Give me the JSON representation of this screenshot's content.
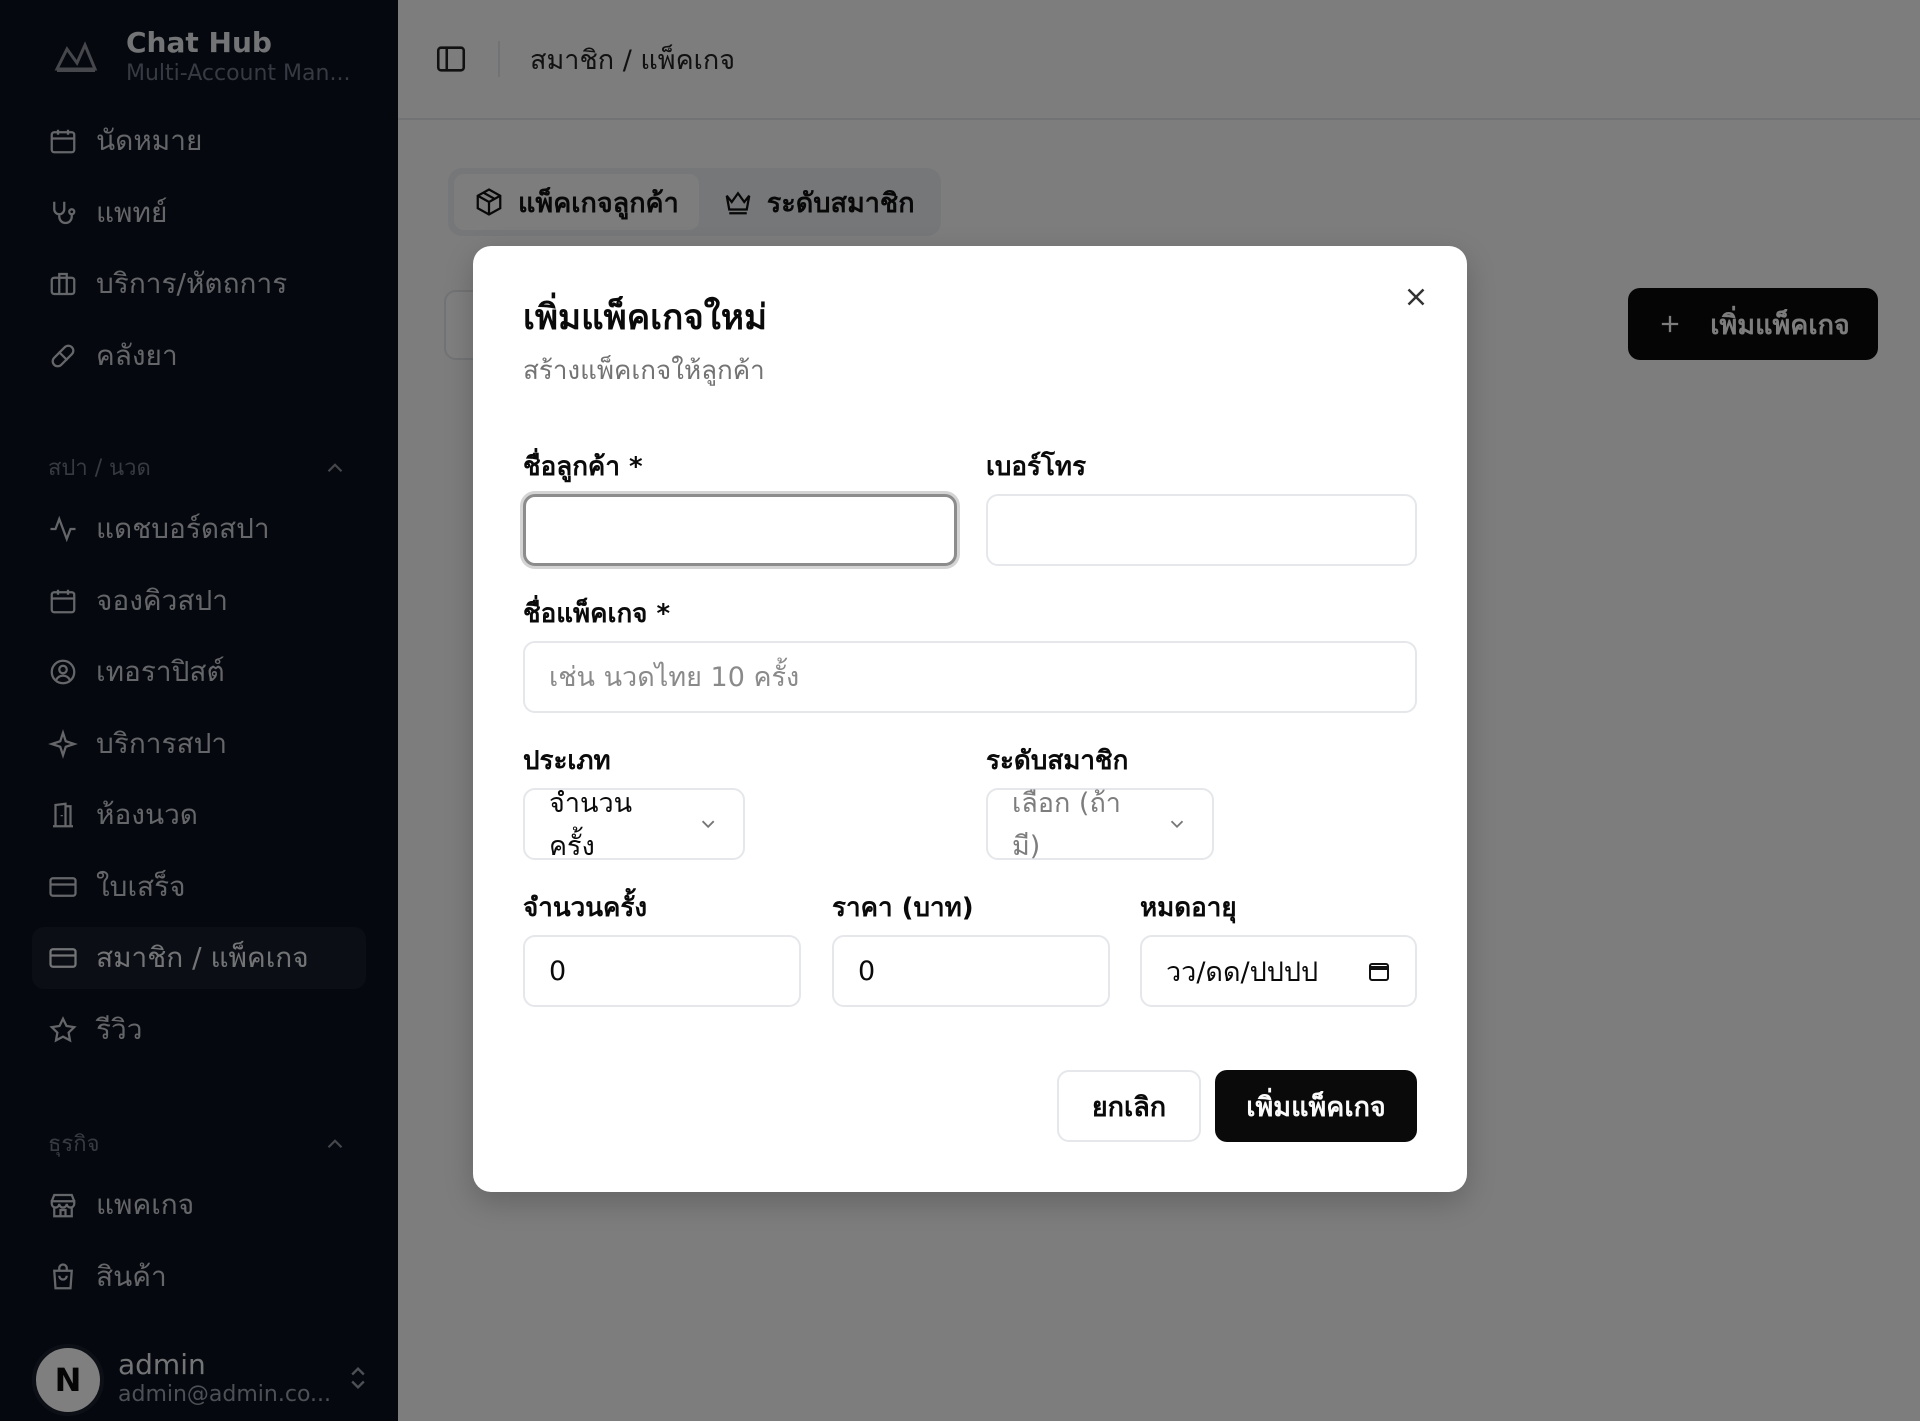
{
  "brand": {
    "name": "Chat Hub",
    "subtitle": "Multi-Account Man..."
  },
  "sidebar": {
    "items_top": [
      {
        "label": "นัดหมาย",
        "icon": "calendar-icon"
      },
      {
        "label": "แพทย์",
        "icon": "stethoscope-icon"
      },
      {
        "label": "บริการ/หัตถการ",
        "icon": "briefcase-icon"
      },
      {
        "label": "คลังยา",
        "icon": "pill-icon"
      }
    ],
    "group_spa": {
      "label": "สปา / นวด",
      "items": [
        {
          "label": "แดชบอร์ดสปา",
          "icon": "activity-icon"
        },
        {
          "label": "จองคิวสปา",
          "icon": "calendar-icon"
        },
        {
          "label": "เทอราปิสต์",
          "icon": "user-circle-icon"
        },
        {
          "label": "บริการสปา",
          "icon": "sparkle-icon"
        },
        {
          "label": "ห้องนวด",
          "icon": "door-icon"
        },
        {
          "label": "ใบเสร็จ",
          "icon": "card-icon"
        },
        {
          "label": "สมาชิก / แพ็คเกจ",
          "icon": "card-icon",
          "active": true
        },
        {
          "label": "รีวิว",
          "icon": "star-icon"
        }
      ]
    },
    "group_business": {
      "label": "ธุรกิจ",
      "items": [
        {
          "label": "แพคเกจ",
          "icon": "store-icon"
        },
        {
          "label": "สินค้า",
          "icon": "bag-icon"
        }
      ]
    },
    "user": {
      "initial": "N",
      "name": "admin",
      "email": "admin@admin.co..."
    }
  },
  "header": {
    "breadcrumb": "สมาชิก / แพ็คเกจ"
  },
  "tabs": [
    {
      "label": "แพ็คเกจลูกค้า",
      "icon": "package-icon",
      "active": true
    },
    {
      "label": "ระดับสมาชิก",
      "icon": "crown-icon",
      "active": false
    }
  ],
  "main": {
    "add_button": "เพิ่มแพ็คเกจ"
  },
  "modal": {
    "title": "เพิ่มแพ็คเกจใหม่",
    "description": "สร้างแพ็คเกจให้ลูกค้า",
    "customer_name_label": "ชื่อลูกค้า *",
    "customer_name_value": "",
    "phone_label": "เบอร์โทร",
    "phone_value": "",
    "package_name_label": "ชื่อแพ็คเกจ *",
    "package_name_placeholder": "เช่น นวดไทย 10 ครั้ง",
    "type_label": "ประเภท",
    "type_value": "จำนวนครั้ง",
    "tier_label": "ระดับสมาชิก",
    "tier_placeholder": "เลือก (ถ้ามี)",
    "sessions_label": "จำนวนครั้ง",
    "sessions_value": "0",
    "price_label": "ราคา (บาท)",
    "price_value": "0",
    "expiry_label": "หมดอายุ",
    "expiry_placeholder": "วว/ดด/ปปปป",
    "cancel_label": "ยกเลิก",
    "submit_label": "เพิ่มแพ็คเกจ"
  }
}
